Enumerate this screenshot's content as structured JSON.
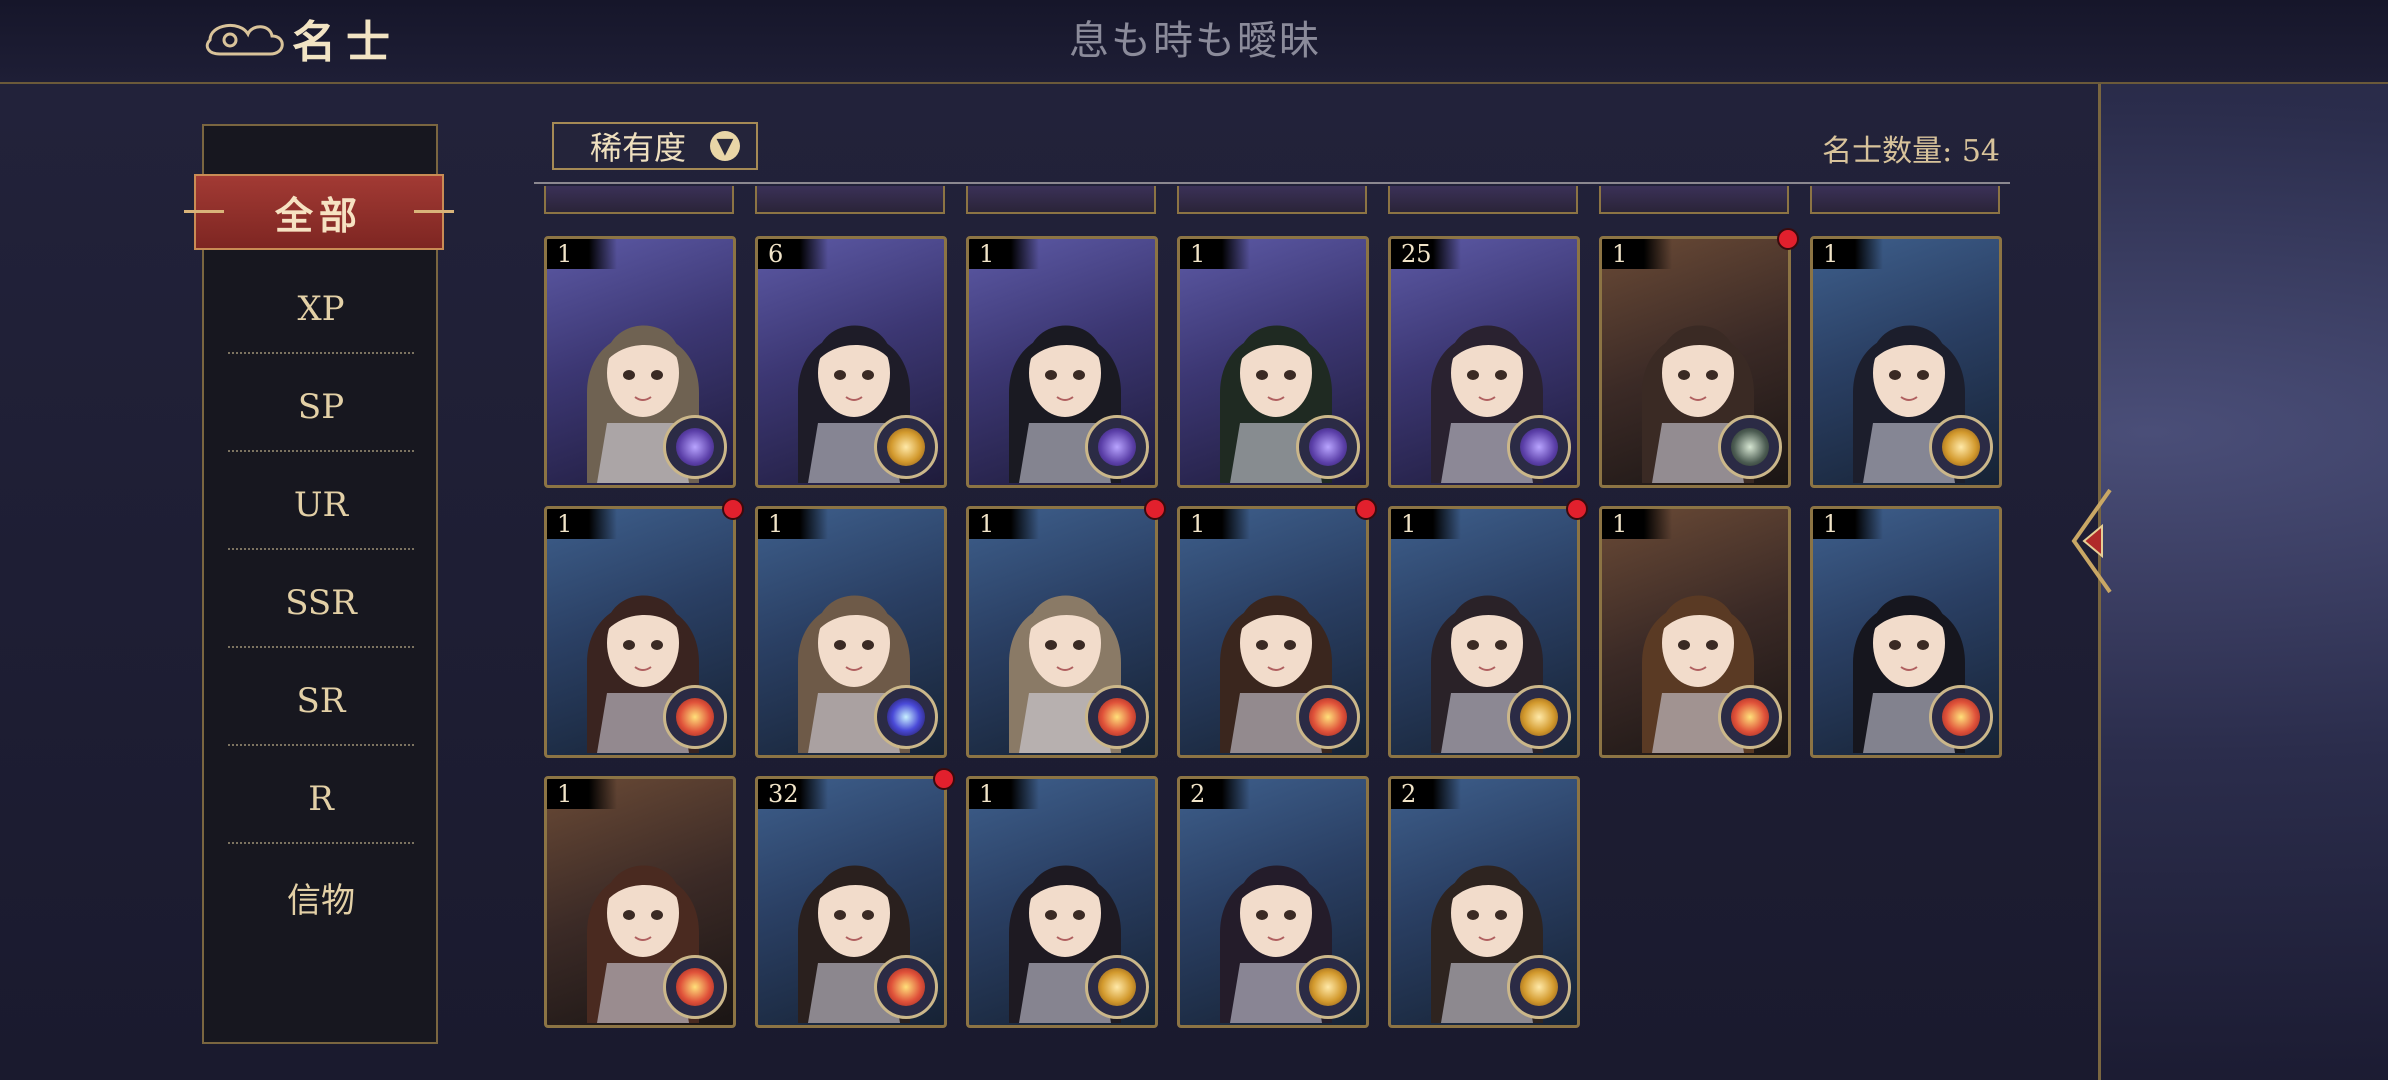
{
  "header": {
    "title": "名士",
    "subtitle": "息も時も曖昧"
  },
  "nav": {
    "active": "全部",
    "items": [
      "XP",
      "SP",
      "UR",
      "SSR",
      "SR",
      "R",
      "信物"
    ]
  },
  "filter": {
    "label": "稀有度",
    "icon": "chevron-down-icon"
  },
  "count": {
    "text": "名士数量: 54"
  },
  "cards": [
    {
      "level": "1",
      "bg": "purple",
      "emblem": "violet",
      "alert": false
    },
    {
      "level": "6",
      "bg": "purple",
      "emblem": "gold",
      "alert": false
    },
    {
      "level": "1",
      "bg": "purple",
      "emblem": "violet",
      "alert": false
    },
    {
      "level": "1",
      "bg": "purple",
      "emblem": "violet",
      "alert": false
    },
    {
      "level": "25",
      "bg": "purple",
      "emblem": "violet",
      "alert": false
    },
    {
      "level": "1",
      "bg": "brown",
      "emblem": "compass",
      "alert": true
    },
    {
      "level": "1",
      "bg": "blue",
      "emblem": "gold",
      "alert": false
    },
    {
      "level": "1",
      "bg": "blue",
      "emblem": "red",
      "alert": true
    },
    {
      "level": "1",
      "bg": "blue",
      "emblem": "cosmic",
      "alert": false
    },
    {
      "level": "1",
      "bg": "blue",
      "emblem": "red",
      "alert": true
    },
    {
      "level": "1",
      "bg": "blue",
      "emblem": "red",
      "alert": true
    },
    {
      "level": "1",
      "bg": "blue",
      "emblem": "gold",
      "alert": true
    },
    {
      "level": "1",
      "bg": "brown",
      "emblem": "red",
      "alert": false
    },
    {
      "level": "1",
      "bg": "blue",
      "emblem": "red",
      "alert": false
    },
    {
      "level": "1",
      "bg": "brown",
      "emblem": "red",
      "alert": false
    },
    {
      "level": "32",
      "bg": "blue",
      "emblem": "red",
      "alert": true
    },
    {
      "level": "1",
      "bg": "blue",
      "emblem": "gold",
      "alert": false
    },
    {
      "level": "2",
      "bg": "blue",
      "emblem": "gold",
      "alert": false
    },
    {
      "level": "2",
      "bg": "blue",
      "emblem": "gold",
      "alert": false
    }
  ]
}
